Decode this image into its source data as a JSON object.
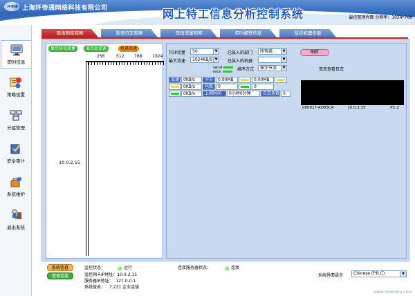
{
  "header": {
    "logo_text": "环帝通",
    "company": "上海环帝通网络科技有限公司",
    "title": "网上特工信息分析控制系统",
    "resolution": "最佳管理界面 分辨率：1024*768"
  },
  "sidebar": {
    "items": [
      {
        "label": "即时信息",
        "icon": "monitor-icon"
      },
      {
        "label": "策略设置",
        "icon": "policy-icon"
      },
      {
        "label": "分组管理",
        "icon": "group-icon"
      },
      {
        "label": "安全审计",
        "icon": "audit-icon"
      },
      {
        "label": "系统维护",
        "icon": "maintenance-icon"
      },
      {
        "label": "退出系统",
        "icon": "exit-icon"
      }
    ]
  },
  "tabs": [
    "现场图库观察",
    "现场日志观察",
    "现场流量观察",
    "实时报警信息",
    "监控机器负载"
  ],
  "monitor": {
    "buttons": [
      "显示协议流量",
      "显示总流速",
      "机器流速"
    ],
    "scale": [
      "256",
      "512",
      "768",
      "1024"
    ],
    "ip": "10.0.2.15"
  },
  "controls": {
    "top_label": "TOP流量",
    "top_value": "50",
    "max_label": "最大流速",
    "max_value": "1024KB/S",
    "dept_label": "已装入的部门",
    "dept_value": "所有组",
    "machine_label": "已装入的机器",
    "machine_value": "",
    "sort_label": "排序方式",
    "sort_value": "按字节流",
    "refresh": "刷新",
    "send_label": "send",
    "recv_label": "recv",
    "dblclick_label": "双击查看日志"
  },
  "stats": {
    "speed_label": "流速",
    "speed_values": [
      "0KB/s",
      "0KB/s",
      "0KB/s"
    ],
    "bytes_label": "字节",
    "bytes_value": "0.00MB",
    "bytes_value2": "0.00MB",
    "packets_label": "包数",
    "packets_value": "0",
    "packets_value2": "0",
    "online_label": "上网时间",
    "online_value": "0小时0分钟",
    "log_label": "日志条数",
    "log_value": "0"
  },
  "machine": {
    "mac": "080027-AD83CA",
    "ip": "10.0.2.15",
    "name": "PC-2"
  },
  "status": {
    "btn_info": "系统信息",
    "btn_admin": "管理连接",
    "monitor_state_label": "监控状态：",
    "monitor_state_value": "运行",
    "nic_ip_label": "监控网卡IP地址：",
    "nic_ip_value": "10.0.2.15",
    "server_ip_label": "服务器IP地址：",
    "server_ip_value": "127.0.0.1",
    "version_label": "系统版本：",
    "version_value": "7.231  企业金版",
    "conn_state_label": "连接服务器状态：",
    "conn_state_value": "连接",
    "lang_label": "系统界面语言",
    "lang_value": "Chinese (P.R.C)"
  },
  "watermark": "www.downxia.com",
  "colors": {
    "header_blue": "#2f66b8",
    "tab_active": "#c42828",
    "tab_inactive": "#4a77b8",
    "panel_bg": "#c9d9ee",
    "ok_green": "#38b23a",
    "send_green": "#22cc22",
    "recv_green": "#33cc33"
  }
}
